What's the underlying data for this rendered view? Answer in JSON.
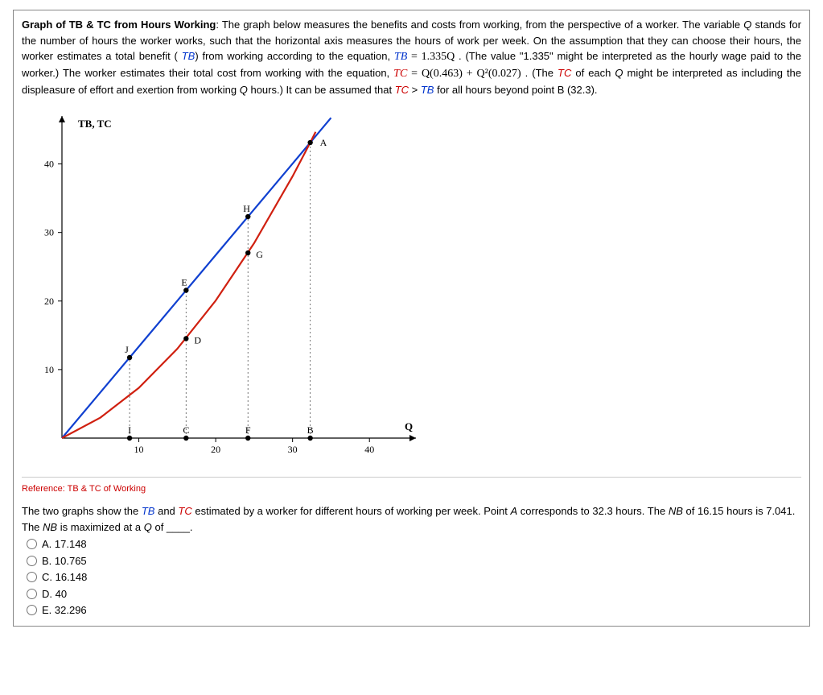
{
  "intro": {
    "title": "Graph of TB & TC from Hours Working",
    "text_1": ": The graph below measures the benefits and costs from working, from the perspective of a worker. The variable ",
    "var_q": "Q",
    "text_2": " stands for the number of hours the worker works, such that the horizontal axis measures the hours of work per week. On the assumption that they can choose their hours, the worker estimates a total benefit ( ",
    "tb_label_1": "TB",
    "text_3": ") from working according to the equation, ",
    "eq_tb": " = 1.335Q",
    "text_4": " . (The value \"1.335\" might be interpreted as the hourly wage paid to the worker.) The worker estimates their total cost from working with the equation, ",
    "eq_tc": " = Q(0.463) + Q²(0.027)",
    "text_5": " . (The ",
    "tc_label_2": "TC",
    "text_6": " of each ",
    "text_7": " might be interpreted as including the displeasure of effort and exertion from working ",
    "text_8": " hours.) It can be assumed that ",
    "text_9": " > ",
    "text_10": " for all hours beyond point B (32.3)."
  },
  "reference_label": "Reference: TB & TC of Working",
  "question": {
    "pre": "The two graphs show the ",
    "tb_label": "TB",
    "mid1": " and ",
    "tc_label": "TC",
    "mid2": " estimated by a worker for different hours of working per week. Point ",
    "point_a": "A",
    "mid3": " corresponds to 32.3 hours. The ",
    "nb_label": "NB",
    "mid4": " of 16.15 hours is 7.041. The ",
    "mid5": " is maximized at a ",
    "q_label": "Q",
    "tail": " of ____."
  },
  "choices": [
    {
      "letter": "A.",
      "text": "17.148"
    },
    {
      "letter": "B.",
      "text": "10.765"
    },
    {
      "letter": "C.",
      "text": "16.148"
    },
    {
      "letter": "D.",
      "text": "40"
    },
    {
      "letter": "E.",
      "text": "32.296"
    }
  ],
  "chart_data": {
    "type": "line",
    "title": "TB, TC",
    "xlabel": "Q",
    "ylabel": "TB, TC",
    "xlim": [
      0,
      45
    ],
    "ylim": [
      0,
      47
    ],
    "xticks": [
      10,
      20,
      30,
      40
    ],
    "yticks": [
      10,
      20,
      30,
      40
    ],
    "series": [
      {
        "name": "TB",
        "color": "#1040d0",
        "x": [
          0,
          5,
          10,
          15,
          20,
          25,
          30,
          32.3,
          35
        ],
        "y": [
          0,
          6.675,
          13.35,
          20.025,
          26.7,
          33.375,
          40.05,
          43.12,
          46.725
        ]
      },
      {
        "name": "TC",
        "color": "#d02010",
        "x": [
          0,
          5,
          10,
          15,
          20,
          25,
          30,
          32.3,
          33
        ],
        "y": [
          0,
          2.99,
          7.33,
          13.02,
          20.06,
          28.45,
          38.19,
          43.12,
          44.68
        ]
      }
    ],
    "points": [
      {
        "label": "A",
        "x": 32.3,
        "y": 43.12,
        "on": "intersection"
      },
      {
        "label": "B",
        "x": 32.3,
        "y": 0,
        "on": "axis"
      },
      {
        "label": "C",
        "x": 16.15,
        "y": 0,
        "on": "axis"
      },
      {
        "label": "D",
        "x": 16.15,
        "y": 14.52,
        "on": "TC"
      },
      {
        "label": "E",
        "x": 16.15,
        "y": 21.56,
        "on": "TB"
      },
      {
        "label": "F",
        "x": 24.2,
        "y": 0,
        "on": "axis"
      },
      {
        "label": "G",
        "x": 24.2,
        "y": 27.02,
        "on": "TC"
      },
      {
        "label": "H",
        "x": 24.2,
        "y": 32.31,
        "on": "TB"
      },
      {
        "label": "I",
        "x": 8.8,
        "y": 0,
        "on": "axis"
      },
      {
        "label": "J",
        "x": 8.8,
        "y": 11.75,
        "on": "TB"
      }
    ]
  }
}
